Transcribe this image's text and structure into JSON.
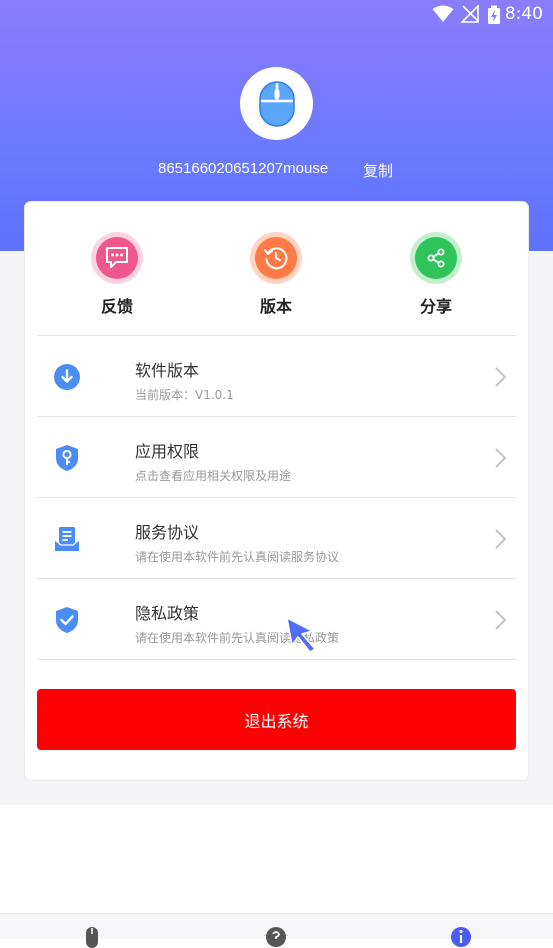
{
  "status_bar": {
    "time": "8:40"
  },
  "profile": {
    "device_id": "865166020651207mouse",
    "copy_label": "复制",
    "avatar_icon": "mouse-icon"
  },
  "quick_actions": [
    {
      "label": "反馈",
      "icon": "feedback-icon",
      "color": "#f0578f"
    },
    {
      "label": "版本",
      "icon": "history-clock-icon",
      "color": "#ff7a45"
    },
    {
      "label": "分享",
      "icon": "share-icon",
      "color": "#2fc45a"
    }
  ],
  "menu": [
    {
      "title": "软件版本",
      "subtitle": "当前版本：V1.0.1",
      "icon": "download-icon"
    },
    {
      "title": "应用权限",
      "subtitle": "点击查看应用相关权限及用途",
      "icon": "key-shield-icon"
    },
    {
      "title": "服务协议",
      "subtitle": "请在使用本软件前先认真阅读服务协议",
      "icon": "agreement-icon"
    },
    {
      "title": "隐私政策",
      "subtitle": "请在使用本软件前先认真阅读隐私政策",
      "icon": "privacy-shield-icon"
    }
  ],
  "logout_label": "退出系统",
  "colors": {
    "header_gradient_top": "#8b7cfb",
    "header_gradient_bottom": "#5d72ff",
    "logout": "#ff0000",
    "menu_icon_blue": "#4a8ef5",
    "tab_active": "#4a5cf5"
  }
}
